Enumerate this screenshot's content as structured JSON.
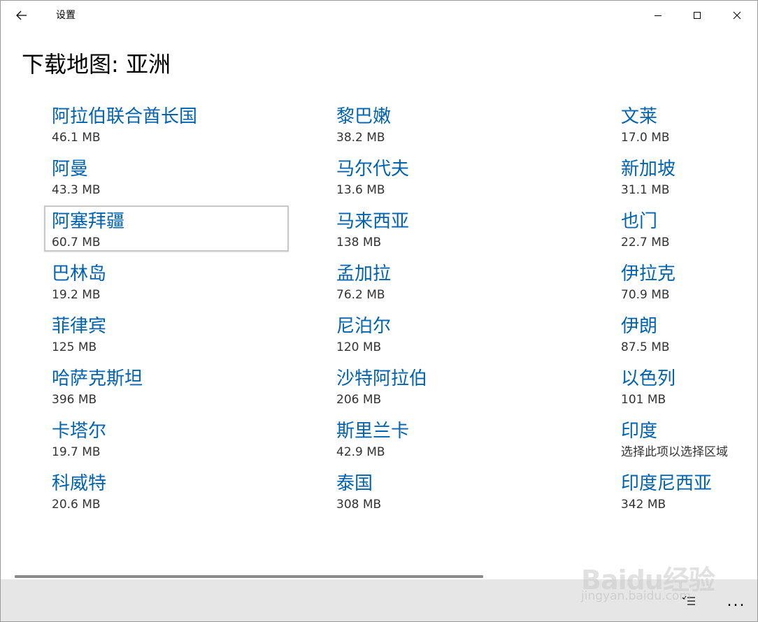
{
  "window": {
    "app_title": "设置",
    "icons": {
      "back": "back-arrow-icon",
      "minimize": "minimize-icon",
      "maximize": "maximize-icon",
      "close": "close-icon"
    }
  },
  "page": {
    "title": "下载地图: 亚洲"
  },
  "regions": [
    {
      "name": "阿拉伯联合酋长国",
      "size": "46.1 MB"
    },
    {
      "name": "阿曼",
      "size": "43.3 MB"
    },
    {
      "name": "阿塞拜疆",
      "size": "60.7 MB"
    },
    {
      "name": "巴林岛",
      "size": "19.2 MB"
    },
    {
      "name": "菲律宾",
      "size": "125 MB"
    },
    {
      "name": "哈萨克斯坦",
      "size": "396 MB"
    },
    {
      "name": "卡塔尔",
      "size": "19.7 MB"
    },
    {
      "name": "科威特",
      "size": "20.6 MB"
    },
    {
      "name": "黎巴嫩",
      "size": "38.2 MB"
    },
    {
      "name": "马尔代夫",
      "size": "13.6 MB"
    },
    {
      "name": "马来西亚",
      "size": "138 MB"
    },
    {
      "name": "孟加拉",
      "size": "76.2 MB"
    },
    {
      "name": "尼泊尔",
      "size": "120 MB"
    },
    {
      "name": "沙特阿拉伯",
      "size": "206 MB"
    },
    {
      "name": "斯里兰卡",
      "size": "42.9 MB"
    },
    {
      "name": "泰国",
      "size": "308 MB"
    },
    {
      "name": "文莱",
      "size": "17.0 MB"
    },
    {
      "name": "新加坡",
      "size": "31.1 MB"
    },
    {
      "name": "也门",
      "size": "22.7 MB"
    },
    {
      "name": "伊拉克",
      "size": "70.9 MB"
    },
    {
      "name": "伊朗",
      "size": "87.5 MB"
    },
    {
      "name": "以色列",
      "size": "101 MB"
    },
    {
      "name": "印度",
      "size": "选择此项以选择区域"
    },
    {
      "name": "印度尼西亚",
      "size": "342 MB"
    }
  ],
  "focused_region_index": 2,
  "accent_color": "#0063b1",
  "command_bar": {
    "more_label": "...",
    "icons": {
      "select": "multi-select-icon",
      "more": "more-icon"
    }
  },
  "watermark": {
    "main": "Baidu经验",
    "sub": "jingyan.baidu.com"
  }
}
